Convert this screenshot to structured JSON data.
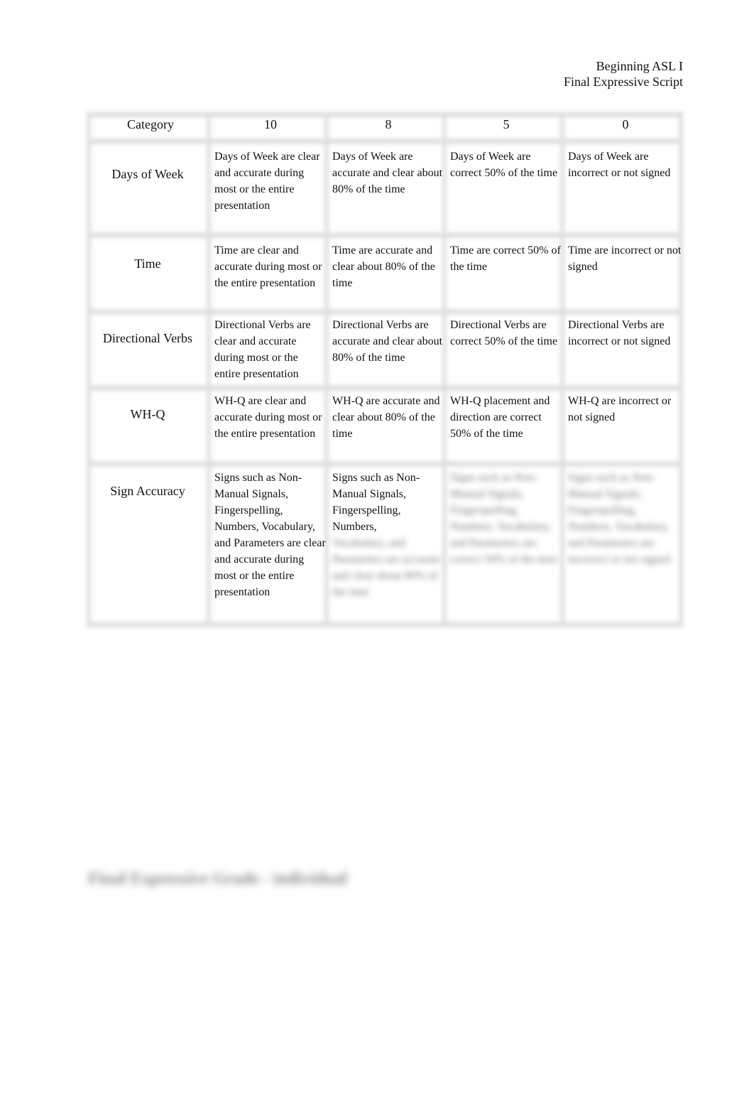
{
  "header": {
    "course": "Beginning ASL I",
    "assignment": "Final Expressive Script"
  },
  "rubric": {
    "columns": [
      "Category",
      "10",
      "8",
      "5",
      "0"
    ],
    "rows": [
      {
        "category": "Days of Week",
        "cells": [
          {
            "text": "Days of Week are clear and accurate during most or the entire presentation"
          },
          {
            "text": "Days of Week are accurate and clear about 80% of the time"
          },
          {
            "text": "Days of Week are correct 50% of the time"
          },
          {
            "text": "Days of Week are incorrect or not signed"
          }
        ]
      },
      {
        "category": "Time",
        "cells": [
          {
            "text": "Time are clear and accurate during most or the entire presentation"
          },
          {
            "text": "Time are accurate and clear about 80% of the time"
          },
          {
            "text": "Time are correct 50% of the time"
          },
          {
            "text": "Time are incorrect or not signed"
          }
        ]
      },
      {
        "category": "Directional Verbs",
        "cells": [
          {
            "text": "Directional Verbs are clear and accurate during most or the entire presentation"
          },
          {
            "text": "Directional Verbs are accurate and clear about 80% of the time"
          },
          {
            "text": "Directional Verbs are correct 50% of the time"
          },
          {
            "text": "Directional Verbs are incorrect or not signed"
          }
        ]
      },
      {
        "category": "WH-Q",
        "cells": [
          {
            "text": "WH-Q are clear and accurate during most or the entire presentation"
          },
          {
            "text": "WH-Q are accurate and clear about 80% of the time"
          },
          {
            "text": "WH-Q placement and direction are correct 50% of the time"
          },
          {
            "text": "WH-Q are incorrect or not signed"
          }
        ]
      },
      {
        "category": "Sign Accuracy",
        "cells": [
          {
            "text": "Signs such as Non-Manual Signals, Fingerspelling, Numbers, Vocabulary, and Parameters are clear and accurate during most or the entire presentation"
          },
          {
            "visible_text": "Signs such as Non-Manual Signals, Fingerspelling, Numbers,",
            "obscured_placeholder": "Vocabulary, and Parameters are accurate and clear about 80% of the time"
          },
          {
            "obscured_placeholder": "Signs such as Non-Manual Signals, Fingerspelling, Numbers, Vocabulary, and Parameters are correct 50% of the time"
          },
          {
            "obscured_placeholder": "Signs such as Non-Manual Signals, Fingerspelling, Numbers, Vocabulary, and Parameters are incorrect or not signed"
          }
        ]
      }
    ]
  },
  "footer": {
    "obscured_heading_placeholder": "Final Expressive Grade - individual"
  }
}
